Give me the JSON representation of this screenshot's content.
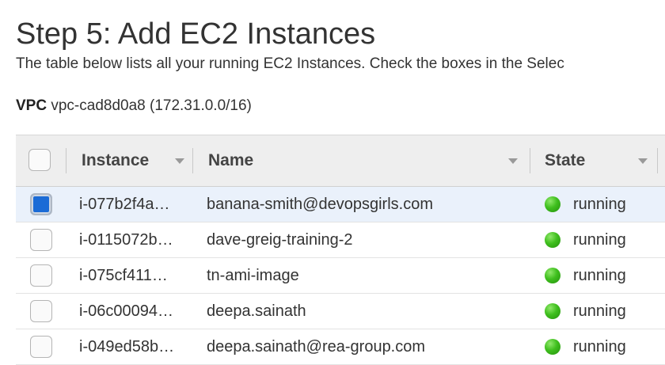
{
  "page": {
    "title": "Step 5: Add EC2 Instances",
    "description": "The table below lists all your running EC2 Instances. Check the boxes in the Selec",
    "vpc_label": "VPC",
    "vpc_value": "vpc-cad8d0a8 (172.31.0.0/16)"
  },
  "table": {
    "columns": [
      "Instance",
      "Name",
      "State"
    ],
    "rows": [
      {
        "instance": "i-077b2f4a…",
        "name": "banana-smith@devopsgirls.com",
        "state": "running",
        "checked": true
      },
      {
        "instance": "i-0115072b…",
        "name": "dave-greig-training-2",
        "state": "running",
        "checked": false
      },
      {
        "instance": "i-075cf411…",
        "name": "tn-ami-image",
        "state": "running",
        "checked": false
      },
      {
        "instance": "i-06c00094…",
        "name": "deepa.sainath",
        "state": "running",
        "checked": false
      },
      {
        "instance": "i-049ed58b…",
        "name": "deepa.sainath@rea-group.com",
        "state": "running",
        "checked": false
      }
    ]
  },
  "colors": {
    "status_running": "#3fbf1e",
    "checkbox_checked": "#1b6bd6",
    "selected_row": "#eaf1fb"
  },
  "icons": {
    "state": "green-dot-icon",
    "sort": "caret-down-icon"
  }
}
